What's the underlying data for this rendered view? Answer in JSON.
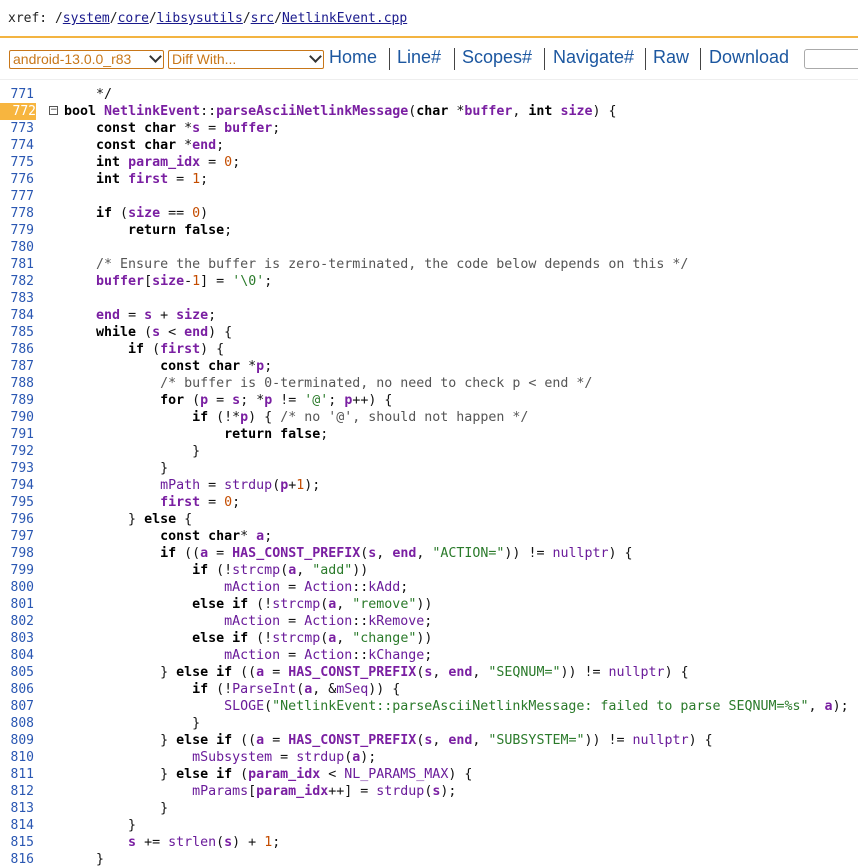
{
  "header": {
    "xref_prefix": "xref: /",
    "path_segments": [
      "system",
      "core",
      "libsysutils",
      "src",
      "NetlinkEvent.cpp"
    ]
  },
  "toolbar": {
    "version_select": "android-13.0.0_r83",
    "diff_select": "Diff With...",
    "links": [
      "Home",
      "Line#",
      "Scopes#",
      "Navigate#",
      "Raw",
      "Download"
    ]
  },
  "code": {
    "highlighted_line": 772,
    "lines": [
      {
        "no": 771,
        "text": "    */"
      },
      {
        "no": 772,
        "text": "bool NetlinkEvent::parseAsciiNetlinkMessage(char *buffer, int size) {"
      },
      {
        "no": 773,
        "text": "    const char *s = buffer;"
      },
      {
        "no": 774,
        "text": "    const char *end;"
      },
      {
        "no": 775,
        "text": "    int param_idx = 0;"
      },
      {
        "no": 776,
        "text": "    int first = 1;"
      },
      {
        "no": 777,
        "text": ""
      },
      {
        "no": 778,
        "text": "    if (size == 0)"
      },
      {
        "no": 779,
        "text": "        return false;"
      },
      {
        "no": 780,
        "text": ""
      },
      {
        "no": 781,
        "text": "    /* Ensure the buffer is zero-terminated, the code below depends on this */"
      },
      {
        "no": 782,
        "text": "    buffer[size-1] = '\\0';"
      },
      {
        "no": 783,
        "text": ""
      },
      {
        "no": 784,
        "text": "    end = s + size;"
      },
      {
        "no": 785,
        "text": "    while (s < end) {"
      },
      {
        "no": 786,
        "text": "        if (first) {"
      },
      {
        "no": 787,
        "text": "            const char *p;"
      },
      {
        "no": 788,
        "text": "            /* buffer is 0-terminated, no need to check p < end */"
      },
      {
        "no": 789,
        "text": "            for (p = s; *p != '@'; p++) {"
      },
      {
        "no": 790,
        "text": "                if (!*p) { /* no '@', should not happen */"
      },
      {
        "no": 791,
        "text": "                    return false;"
      },
      {
        "no": 792,
        "text": "                }"
      },
      {
        "no": 793,
        "text": "            }"
      },
      {
        "no": 794,
        "text": "            mPath = strdup(p+1);"
      },
      {
        "no": 795,
        "text": "            first = 0;"
      },
      {
        "no": 796,
        "text": "        } else {"
      },
      {
        "no": 797,
        "text": "            const char* a;"
      },
      {
        "no": 798,
        "text": "            if ((a = HAS_CONST_PREFIX(s, end, \"ACTION=\")) != nullptr) {"
      },
      {
        "no": 799,
        "text": "                if (!strcmp(a, \"add\"))"
      },
      {
        "no": 800,
        "text": "                    mAction = Action::kAdd;"
      },
      {
        "no": 801,
        "text": "                else if (!strcmp(a, \"remove\"))"
      },
      {
        "no": 802,
        "text": "                    mAction = Action::kRemove;"
      },
      {
        "no": 803,
        "text": "                else if (!strcmp(a, \"change\"))"
      },
      {
        "no": 804,
        "text": "                    mAction = Action::kChange;"
      },
      {
        "no": 805,
        "text": "            } else if ((a = HAS_CONST_PREFIX(s, end, \"SEQNUM=\")) != nullptr) {"
      },
      {
        "no": 806,
        "text": "                if (!ParseInt(a, &mSeq)) {"
      },
      {
        "no": 807,
        "text": "                    SLOGE(\"NetlinkEvent::parseAsciiNetlinkMessage: failed to parse SEQNUM=%s\", a);"
      },
      {
        "no": 808,
        "text": "                }"
      },
      {
        "no": 809,
        "text": "            } else if ((a = HAS_CONST_PREFIX(s, end, \"SUBSYSTEM=\")) != nullptr) {"
      },
      {
        "no": 810,
        "text": "                mSubsystem = strdup(a);"
      },
      {
        "no": 811,
        "text": "            } else if (param_idx < NL_PARAMS_MAX) {"
      },
      {
        "no": 812,
        "text": "                mParams[param_idx++] = strdup(s);"
      },
      {
        "no": 813,
        "text": "            }"
      },
      {
        "no": 814,
        "text": "        }"
      },
      {
        "no": 815,
        "text": "        s += strlen(s) + 1;"
      },
      {
        "no": 816,
        "text": "    }"
      }
    ]
  },
  "colors": {
    "accent": "#f7b53f",
    "link": "#1c57a0",
    "select_text": "#c87719",
    "identifier": "#7a1fa2"
  }
}
